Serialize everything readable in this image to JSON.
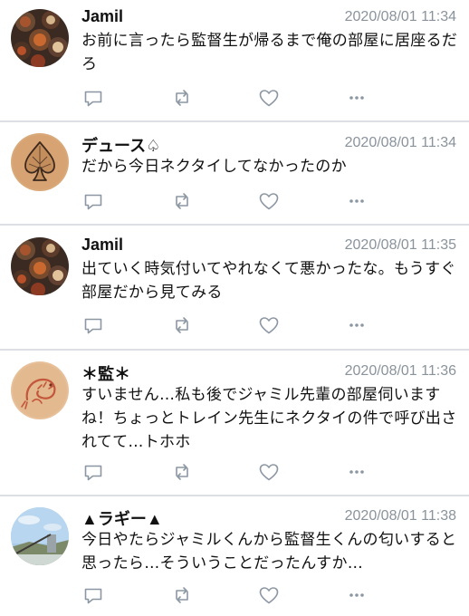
{
  "tweets": [
    {
      "name": "Jamil",
      "time": "2020/08/01 11:34",
      "text": "お前に言ったら監督生が帰るまで俺の部屋に居座るだろ",
      "avatar": "dish-photo-avatar"
    },
    {
      "name": "デュース♤",
      "time": "2020/08/01 11:34",
      "text": "だから今日ネクタイしてなかったのか",
      "avatar": "spade-drawing-avatar"
    },
    {
      "name": "Jamil",
      "time": "2020/08/01 11:35",
      "text": "出ていく時気付いてやれなくて悪かったな。もうすぐ部屋だから見てみる",
      "avatar": "dish-photo-avatar"
    },
    {
      "name": "＊監＊",
      "time": "2020/08/01 11:36",
      "text": "すいません…私も後でジャミル先輩の部屋伺いますね！ちょっとトレイン先生にネクタイの件で呼び出されてて…トホホ",
      "avatar": "shrimp-drawing-avatar"
    },
    {
      "name": "▲ラギー▲",
      "time": "2020/08/01 11:38",
      "text": "今日やたらジャミルくんから監督生くんの匂いすると思ったら…そういうことだったんすか…",
      "avatar": "sky-landscape-avatar"
    }
  ],
  "colors": {
    "icon": "#8c97a3",
    "divider": "#dcdfe3",
    "timestamp": "#8a939c"
  }
}
